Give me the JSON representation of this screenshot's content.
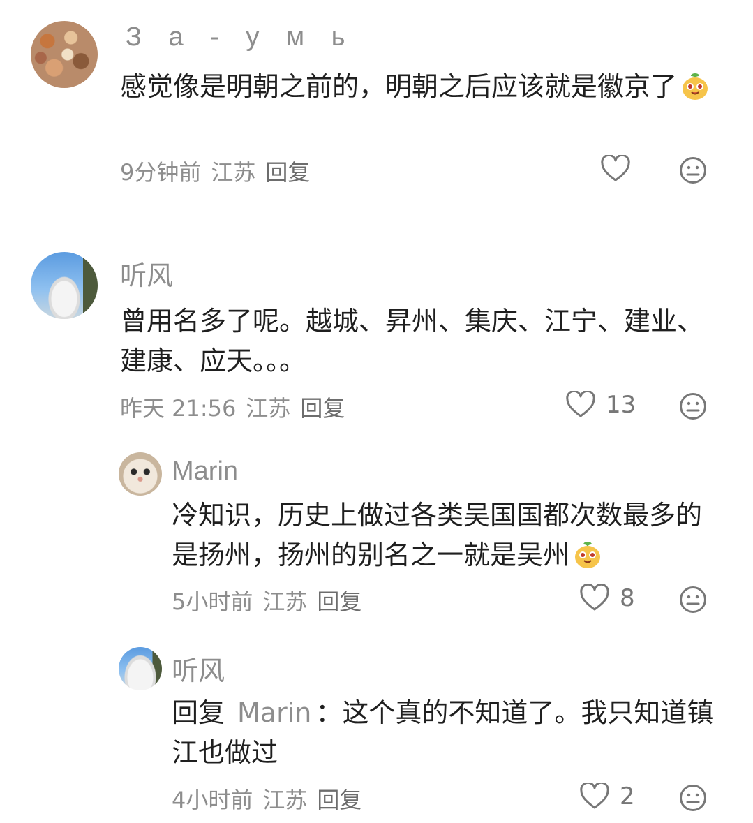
{
  "comments": [
    {
      "username": "З а - у м ь",
      "text": "感觉像是明朝之前的，明朝之后应该就是徽京了",
      "emoji": "smiling-bun-emoji",
      "time": "9分钟前",
      "location": "江苏",
      "reply_label": "回复",
      "likes": ""
    },
    {
      "username": "听风",
      "text": "曾用名多了呢。越城、昇州、集庆、江宁、建业、建康、应天。。。",
      "time": "昨天 21:56",
      "location": "江苏",
      "reply_label": "回复",
      "likes": "13"
    },
    {
      "username": "Marin",
      "text": "冷知识，历史上做过各类吴国国都次数最多的是扬州，扬州的别名之一就是吴州",
      "emoji": "smiling-bun-emoji",
      "time": "5小时前",
      "location": "江苏",
      "reply_label": "回复",
      "likes": "8"
    },
    {
      "username": "听风",
      "reply_prefix": "回复",
      "reply_to": "Marin",
      "reply_colon": "：",
      "text": "这个真的不知道了。我只知道镇江也做过",
      "time": "4小时前",
      "location": "江苏",
      "reply_label": "回复",
      "likes": "2"
    }
  ],
  "colors": {
    "muted": "#8d8d8d",
    "text": "#1f1f1f",
    "icon": "#777777"
  },
  "icons": {
    "like": "heart-outline-icon",
    "dislike": "neutral-face-icon"
  }
}
